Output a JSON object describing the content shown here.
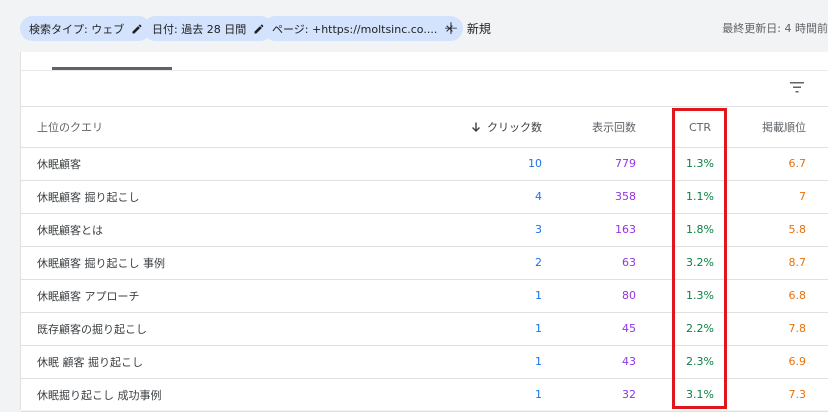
{
  "filters": {
    "chips": [
      {
        "label": "検索タイプ: ウェブ",
        "icon": "edit-icon"
      },
      {
        "label": "日付: 過去 28 日間",
        "icon": "edit-icon"
      },
      {
        "label": "ページ: +https://moltsinc.co....",
        "icon": "close-icon"
      }
    ],
    "new_label": "新規",
    "last_updated": "最終更新日: 4 時間前"
  },
  "table": {
    "headers": {
      "query": "上位のクエリ",
      "clicks": "クリック数",
      "impressions": "表示回数",
      "ctr": "CTR",
      "position": "掲載順位"
    },
    "sort": {
      "column": "clicks",
      "direction": "descending"
    },
    "rows": [
      {
        "query": "休眠顧客",
        "clicks": "10",
        "impressions": "779",
        "ctr": "1.3%",
        "position": "6.7"
      },
      {
        "query": "休眠顧客 掘り起こし",
        "clicks": "4",
        "impressions": "358",
        "ctr": "1.1%",
        "position": "7"
      },
      {
        "query": "休眠顧客とは",
        "clicks": "3",
        "impressions": "163",
        "ctr": "1.8%",
        "position": "5.8"
      },
      {
        "query": "休眠顧客 掘り起こし 事例",
        "clicks": "2",
        "impressions": "63",
        "ctr": "3.2%",
        "position": "8.7"
      },
      {
        "query": "休眠顧客 アプローチ",
        "clicks": "1",
        "impressions": "80",
        "ctr": "1.3%",
        "position": "6.8"
      },
      {
        "query": "既存顧客の掘り起こし",
        "clicks": "1",
        "impressions": "45",
        "ctr": "2.2%",
        "position": "7.8"
      },
      {
        "query": "休眠 顧客 掘り起こし",
        "clicks": "1",
        "impressions": "43",
        "ctr": "2.3%",
        "position": "6.9"
      },
      {
        "query": "休眠掘り起こし 成功事例",
        "clicks": "1",
        "impressions": "32",
        "ctr": "3.1%",
        "position": "7.3"
      }
    ]
  },
  "colors": {
    "clicks": "#1a73e8",
    "impressions": "#9334e6",
    "ctr": "#0b8043",
    "position": "#e8710a",
    "highlight": "#e0181d",
    "chip_bg": "#d3e3fd"
  }
}
